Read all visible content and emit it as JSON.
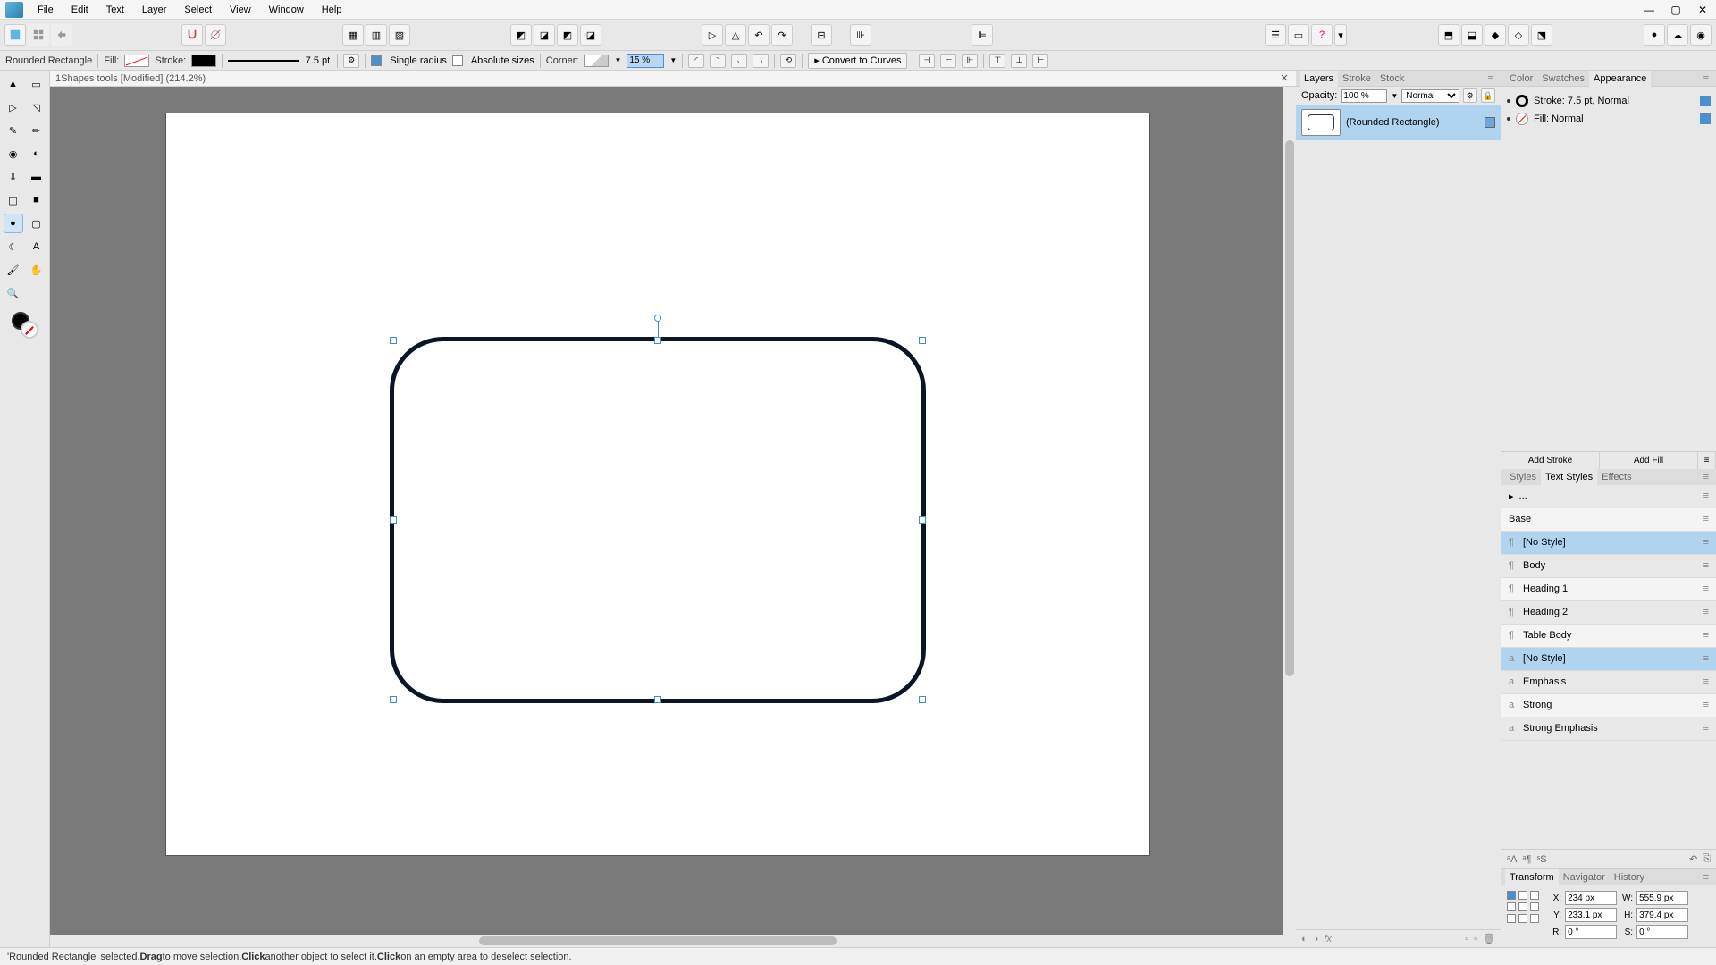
{
  "menu": [
    "File",
    "Edit",
    "Text",
    "Layer",
    "Select",
    "View",
    "Window",
    "Help"
  ],
  "context": {
    "tool_name": "Rounded Rectangle",
    "fill_label": "Fill:",
    "stroke_label": "Stroke:",
    "stroke_width": "7.5 pt",
    "single_radius": "Single radius",
    "absolute_sizes": "Absolute sizes",
    "corner_label": "Corner:",
    "corner_value": "15 %",
    "convert": "Convert to Curves"
  },
  "doc_tab": "1Shapes tools [Modified] (214.2%)",
  "layers": {
    "tab_layers": "Layers",
    "tab_stroke": "Stroke",
    "tab_stock": "Stock",
    "opacity_label": "Opacity:",
    "opacity_value": "100 %",
    "blend": "Normal",
    "item_name": "(Rounded Rectangle)"
  },
  "appearance": {
    "tab_color": "Color",
    "tab_swatches": "Swatches",
    "tab_appearance": "Appearance",
    "stroke_row": "Stroke: 7.5 pt, Normal",
    "fill_row": "Fill: Normal",
    "add_stroke": "Add Stroke",
    "add_fill": "Add Fill"
  },
  "styles": {
    "tab_styles": "Styles",
    "tab_text_styles": "Text Styles",
    "tab_effects": "Effects",
    "current": "...",
    "base": "Base",
    "items": [
      "[No Style]",
      "Body",
      "Heading 1",
      "Heading 2",
      "Table Body",
      "[No Style]",
      "Emphasis",
      "Strong",
      "Strong Emphasis"
    ]
  },
  "transform": {
    "tab_transform": "Transform",
    "tab_navigator": "Navigator",
    "tab_history": "History",
    "x_lbl": "X:",
    "x": "234 px",
    "w_lbl": "W:",
    "w": "555.9 px",
    "y_lbl": "Y:",
    "y": "233.1 px",
    "h_lbl": "H:",
    "h": "379.4 px",
    "r_lbl": "R:",
    "r": "0 °",
    "s_lbl": "S:",
    "s": "0 °"
  },
  "status": {
    "p1": "'Rounded Rectangle' selected. ",
    "b1": "Drag",
    "p2": " to move selection. ",
    "b2": "Click",
    "p3": " another object to select it. ",
    "b3": "Click",
    "p4": " on an empty area to deselect selection."
  }
}
